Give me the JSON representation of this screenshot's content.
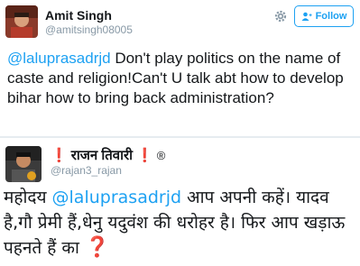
{
  "tweet1": {
    "name": "Amit Singh",
    "handle": "@amitsingh08005",
    "follow_label": "Follow",
    "mention": "@laluprasadrjd",
    "text": " Don't play politics on the name of caste and religion!Can't U talk abt how to develop bihar how to bring back administration?"
  },
  "tweet2": {
    "excl_left": "❗",
    "name": "राजन तिवारी",
    "excl_right": "❗",
    "reg_mark": "®",
    "handle": "@rajan3_rajan",
    "prefix": "महोदय ",
    "mention": "@laluprasadrjd",
    "text": " आप अपनी कहें। यादव है,गौ प्रेमी हैं,धेनु यदुवंश की धरोहर है। फिर आप खड़ाऊ पहनते हैं का ",
    "question_mark": "❓"
  },
  "colors": {
    "accent": "#1da1f2",
    "text": "#14171a",
    "muted": "#8899a6",
    "question": "#e0245e"
  },
  "icons": {
    "gear": "gear-icon",
    "follow": "person-add-icon"
  }
}
